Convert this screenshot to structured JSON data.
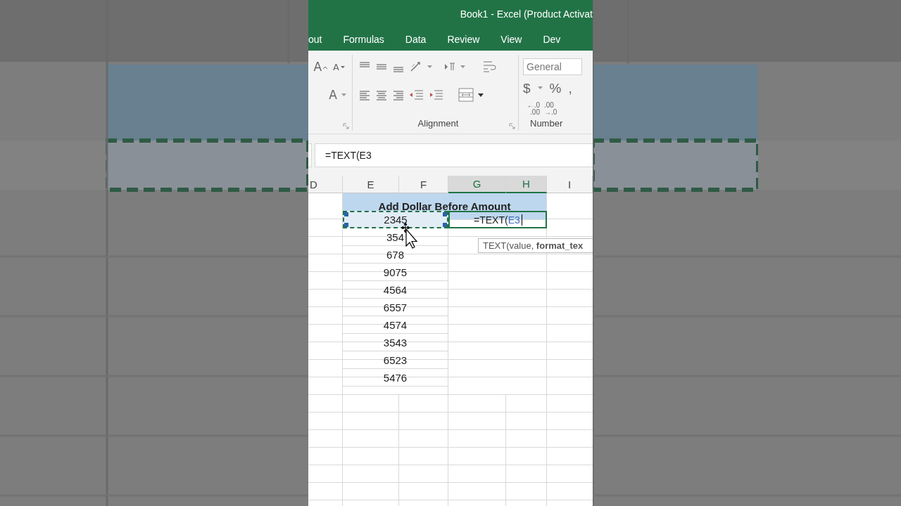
{
  "window": {
    "title": "Book1 - Excel (Product Activat"
  },
  "tabs": [
    {
      "label": "out",
      "selected": false
    },
    {
      "label": "Formulas",
      "selected": false
    },
    {
      "label": "Data",
      "selected": false
    },
    {
      "label": "Review",
      "selected": false
    },
    {
      "label": "View",
      "selected": false
    },
    {
      "label": "Dev",
      "selected": false
    }
  ],
  "ribbon": {
    "font_buttons": [
      {
        "kind": "grow",
        "glyph": "A"
      },
      {
        "kind": "shrink",
        "glyph": "A"
      },
      {
        "kind": "color",
        "glyph": "A"
      }
    ],
    "groups": [
      {
        "label": "Alignment"
      },
      {
        "label": "Number"
      }
    ],
    "number_format": {
      "value": "General"
    },
    "currency_symbol": "$",
    "percent_symbol": "%",
    "comma_symbol": ",",
    "decimal_buttons": [
      {
        "kind": "increase",
        "top": "←.0",
        "bottom": ".00"
      },
      {
        "kind": "decrease",
        "top": ".00",
        "bottom": "→.0"
      }
    ]
  },
  "formula_bar": {
    "value": "=TEXT(E3"
  },
  "sheet": {
    "columns": [
      {
        "label": "D",
        "selected": false
      },
      {
        "label": "E",
        "selected": false
      },
      {
        "label": "F",
        "selected": false
      },
      {
        "label": "G",
        "selected": true
      },
      {
        "label": "H",
        "selected": true
      },
      {
        "label": "I",
        "selected": false
      }
    ],
    "title": "Add Dollar Before Amount",
    "rows": [
      {
        "amount": "2345",
        "copied": true,
        "entry": {
          "text": "=TEXT(",
          "ref": "E3"
        }
      },
      {
        "amount": "354",
        "copied": false
      },
      {
        "amount": "678",
        "copied": false
      },
      {
        "amount": "9075",
        "copied": false
      },
      {
        "amount": "4564",
        "copied": false
      },
      {
        "amount": "6557",
        "copied": false
      },
      {
        "amount": "4574",
        "copied": false
      },
      {
        "amount": "3543",
        "copied": false
      },
      {
        "amount": "6523",
        "copied": false
      },
      {
        "amount": "5476",
        "copied": false
      }
    ],
    "tooltip": "TEXT(value, **format_tex**"
  }
}
